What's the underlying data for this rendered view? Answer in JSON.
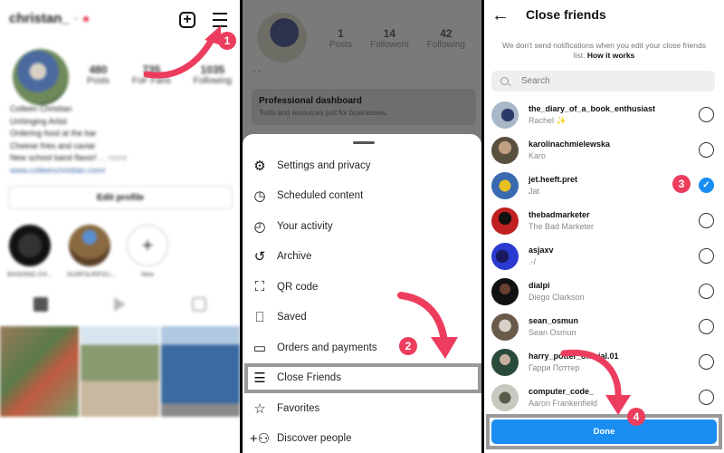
{
  "colors": {
    "accent_blue": "#1a8ef0",
    "annotation_pink": "#ec3d5e",
    "highlight_gray": "#9a9a9a"
  },
  "panel1": {
    "username": "christan_",
    "header_icons": [
      "new-post-icon",
      "hamburger-menu-icon"
    ],
    "stats": [
      {
        "value": "480",
        "label": "Posts"
      },
      {
        "value": "735",
        "label": "FoF Fans"
      },
      {
        "value": "1035",
        "label": "Following"
      }
    ],
    "bio_lines": [
      "Colleen Christian",
      "Unhinging Artist",
      "Ordering food at the bar",
      "Cheese fries and caviar",
      "New school band flavor!"
    ],
    "bio_more": "... more",
    "bio_link": "www.colleenchristian.com/",
    "edit_profile": "Edit profile",
    "highlights": [
      {
        "label": "BASHING CH..."
      },
      {
        "label": "SURFSURFSU..."
      },
      {
        "label": "New"
      }
    ],
    "tabs": [
      "grid-icon",
      "reels-icon",
      "tagged-icon"
    ],
    "nav": [
      "home-icon",
      "search-icon",
      "reels-icon",
      "shop-icon",
      "profile-avatar"
    ],
    "annotation": "1"
  },
  "panel2": {
    "stats": [
      {
        "value": "1",
        "label": "Posts"
      },
      {
        "value": "14",
        "label": "Followers"
      },
      {
        "value": "42",
        "label": "Following"
      }
    ],
    "display_name": "- -",
    "dashboard": {
      "title": "Professional dashboard",
      "subtitle": "Tools and resources just for businesses."
    },
    "menu_items": [
      {
        "label": "Settings and privacy",
        "icon": "settings-icon",
        "glyph": "⚙"
      },
      {
        "label": "Scheduled content",
        "icon": "clock-icon",
        "glyph": "◷"
      },
      {
        "label": "Your activity",
        "icon": "activity-icon",
        "glyph": "◴"
      },
      {
        "label": "Archive",
        "icon": "archive-icon",
        "glyph": "↺"
      },
      {
        "label": "QR code",
        "icon": "qr-code-icon",
        "glyph": "⛶"
      },
      {
        "label": "Saved",
        "icon": "bookmark-icon",
        "glyph": "⎕"
      },
      {
        "label": "Orders and payments",
        "icon": "card-icon",
        "glyph": "▭"
      },
      {
        "label": "Close Friends",
        "icon": "close-friends-list-icon",
        "glyph": "☰",
        "highlighted": true
      },
      {
        "label": "Favorites",
        "icon": "star-icon",
        "glyph": "☆"
      },
      {
        "label": "Discover people",
        "icon": "add-person-icon",
        "glyph": "+⚇"
      }
    ],
    "annotation": "2"
  },
  "panel3": {
    "title": "Close friends",
    "note": "We don't send notifications when you edit your close friends list.",
    "note_link": "How it works",
    "search_placeholder": "Search",
    "friends": [
      {
        "username": "the_diary_of_a_book_enthusiast",
        "name": "Rachel ✨",
        "selected": false
      },
      {
        "username": "karolinachmielewska",
        "name": "Karo",
        "selected": false
      },
      {
        "username": "jet.heeft.pret",
        "name": "Jat",
        "selected": true
      },
      {
        "username": "thebadmarketer",
        "name": "The Bad Marketer",
        "selected": false
      },
      {
        "username": "asjaxv",
        "name": ".-/",
        "selected": false
      },
      {
        "username": "dialpi",
        "name": "Diego Clarkson",
        "selected": false
      },
      {
        "username": "sean_osmun",
        "name": "Sean Osmun",
        "selected": false
      },
      {
        "username": "harry_potter_official.01",
        "name": "Гарри Поттер",
        "selected": false
      },
      {
        "username": "computer_code_",
        "name": "Aaron Frankenfield",
        "selected": false
      }
    ],
    "done": "Done",
    "annotation_select": "3",
    "annotation_done": "4"
  }
}
